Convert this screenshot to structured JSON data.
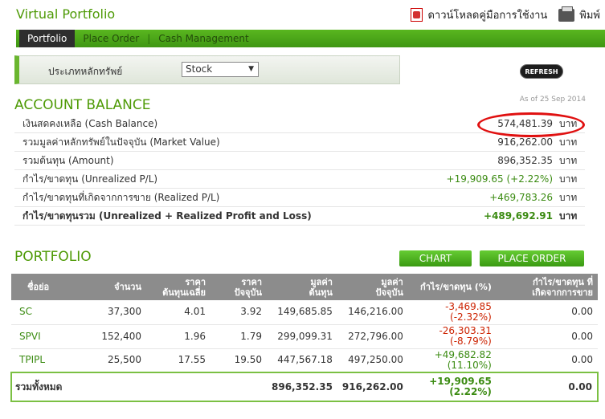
{
  "header": {
    "title": "Virtual Portfolio",
    "download_label": "ดาวน์โหลดคู่มือการใช้งาน",
    "print_label": "พิมพ์"
  },
  "tabs": [
    {
      "label": "Portfolio",
      "active": true
    },
    {
      "label": "Place Order",
      "active": false
    },
    {
      "label": "Cash Management",
      "active": false
    }
  ],
  "filter": {
    "label": "ประเภทหลักทรัพย์",
    "selected": "Stock"
  },
  "refresh_label": "REFRESH",
  "account_balance": {
    "title": "ACCOUNT BALANCE",
    "as_of": "As of 25 Sep 2014",
    "rows": [
      {
        "label": "เงินสดคงเหลือ (Cash Balance)",
        "value": "574,481.39",
        "unit": "บาท"
      },
      {
        "label": "รวมมูลค่าหลักทรัพย์ในปัจจุบัน (Market Value)",
        "value": "916,262.00",
        "unit": "บาท"
      },
      {
        "label": "รวมต้นทุน (Amount)",
        "value": "896,352.35",
        "unit": "บาท"
      },
      {
        "label": "กำไร/ขาดทุน (Unrealized P/L)",
        "value": "+19,909.65 (+2.22%)",
        "unit": "บาท"
      },
      {
        "label": "กำไร/ขาดทุนที่เกิดจากการขาย (Realized P/L)",
        "value": "+469,783.26",
        "unit": "บาท"
      },
      {
        "label": "กำไร/ขาดทุนรวม (Unrealized + Realized Profit and Loss)",
        "value": "+489,692.91",
        "unit": "บาท"
      }
    ]
  },
  "portfolio": {
    "title": "PORTFOLIO",
    "chart_button": "CHART",
    "place_order_button": "PLACE ORDER",
    "columns": [
      [
        "ชื่อย่อ",
        ""
      ],
      [
        "จำนวน",
        ""
      ],
      [
        "ราคา",
        "ต้นทุนเฉลี่ย"
      ],
      [
        "ราคา",
        "ปัจจุบัน"
      ],
      [
        "มูลค่า",
        "ต้นทุน"
      ],
      [
        "มูลค่า",
        "ปัจจุบัน"
      ],
      [
        "กำไร/ขาดทุน (%)",
        ""
      ],
      [
        "กำไร/ขาดทุน ที่",
        "เกิดจากการขาย"
      ]
    ],
    "rows": [
      {
        "symbol": "SC",
        "qty": "37,300",
        "avg_cost": "4.01",
        "price": "3.92",
        "cost_value": "149,685.85",
        "market_value": "146,216.00",
        "pl": "-3,469.85",
        "pl_pct": "(-2.32%)",
        "realized": "0.00"
      },
      {
        "symbol": "SPVI",
        "qty": "152,400",
        "avg_cost": "1.96",
        "price": "1.79",
        "cost_value": "299,099.31",
        "market_value": "272,796.00",
        "pl": "-26,303.31",
        "pl_pct": "(-8.79%)",
        "realized": "0.00"
      },
      {
        "symbol": "TPIPL",
        "qty": "25,500",
        "avg_cost": "17.55",
        "price": "19.50",
        "cost_value": "447,567.18",
        "market_value": "497,250.00",
        "pl": "+49,682.82",
        "pl_pct": "(11.10%)",
        "realized": "0.00"
      }
    ],
    "total": {
      "label": "รวมทั้งหมด",
      "cost_value": "896,352.35",
      "market_value": "916,262.00",
      "pl": "+19,909.65",
      "pl_pct": "(2.22%)",
      "realized": "0.00"
    }
  },
  "colors": {
    "accent_green": "#4e9a06",
    "loss_red": "#cc2200",
    "header_gray": "#8c8c8c"
  }
}
